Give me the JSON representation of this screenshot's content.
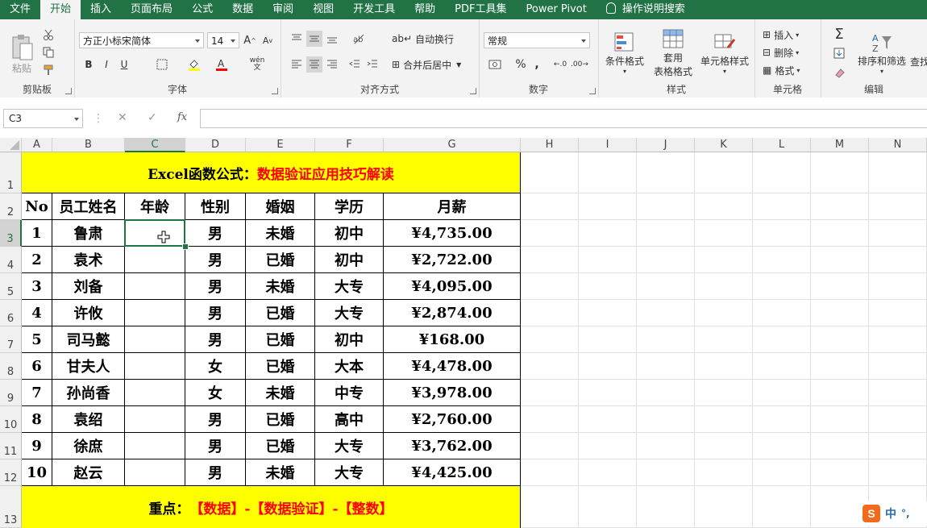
{
  "menu": [
    "文件",
    "开始",
    "插入",
    "页面布局",
    "公式",
    "数据",
    "审阅",
    "视图",
    "开发工具",
    "帮助",
    "PDF工具集",
    "Power Pivot"
  ],
  "menu_active_index": 1,
  "tell_me": "操作说明搜索",
  "ribbon": {
    "clipboard": {
      "paste": "粘贴",
      "label": "剪贴板"
    },
    "font": {
      "name": "方正小标宋简体",
      "size": "14",
      "bold": "B",
      "italic": "I",
      "underline": "U",
      "label": "字体",
      "wen": "wén"
    },
    "align": {
      "wrap": "自动换行",
      "merge": "合并后居中",
      "label": "对齐方式"
    },
    "number": {
      "format": "常规",
      "percent": "%",
      "comma": ",",
      "label": "数字"
    },
    "styles": {
      "cond": "条件格式",
      "table1": "套用",
      "table2": "表格格式",
      "cell": "单元格样式",
      "label": "样式"
    },
    "cells": {
      "insert": "插入",
      "delete": "删除",
      "format": "格式",
      "label": "单元格"
    },
    "editing": {
      "sort": "排序和筛选",
      "find": "查找",
      "label": "编辑"
    }
  },
  "namebox": "C3",
  "fx": "fx",
  "columns": [
    "A",
    "B",
    "C",
    "D",
    "E",
    "F",
    "G",
    "H",
    "I",
    "J",
    "K",
    "L",
    "M",
    "N"
  ],
  "rows": [
    "1",
    "2",
    "3",
    "4",
    "5",
    "6",
    "7",
    "8",
    "9",
    "10",
    "11",
    "12",
    "13"
  ],
  "sheet": {
    "title_black": "Excel函数公式：",
    "title_red": "数据验证应用技巧解读",
    "headers": [
      "No",
      "员工姓名",
      "年龄",
      "性别",
      "婚姻",
      "学历",
      "月薪"
    ],
    "data": [
      [
        "1",
        "鲁肃",
        "",
        "男",
        "未婚",
        "初中",
        "¥4,735.00"
      ],
      [
        "2",
        "袁术",
        "",
        "男",
        "已婚",
        "初中",
        "¥2,722.00"
      ],
      [
        "3",
        "刘备",
        "",
        "男",
        "未婚",
        "大专",
        "¥4,095.00"
      ],
      [
        "4",
        "许攸",
        "",
        "男",
        "已婚",
        "大专",
        "¥2,874.00"
      ],
      [
        "5",
        "司马懿",
        "",
        "男",
        "已婚",
        "初中",
        "¥168.00"
      ],
      [
        "6",
        "甘夫人",
        "",
        "女",
        "已婚",
        "大本",
        "¥4,478.00"
      ],
      [
        "7",
        "孙尚香",
        "",
        "女",
        "未婚",
        "中专",
        "¥3,978.00"
      ],
      [
        "8",
        "袁绍",
        "",
        "男",
        "已婚",
        "高中",
        "¥2,760.00"
      ],
      [
        "9",
        "徐庶",
        "",
        "男",
        "已婚",
        "大专",
        "¥3,762.00"
      ],
      [
        "10",
        "赵云",
        "",
        "男",
        "未婚",
        "大专",
        "¥4,425.00"
      ]
    ],
    "footer_black": "重点：",
    "footer_red": "【数据】-【数据验证】-【整数】"
  },
  "ime": {
    "s": "S",
    "zh": "中",
    "punct": "°,"
  },
  "colors": {
    "excel_green": "#217346",
    "highlight": "#ffff00",
    "emphasis": "#ff0000"
  }
}
